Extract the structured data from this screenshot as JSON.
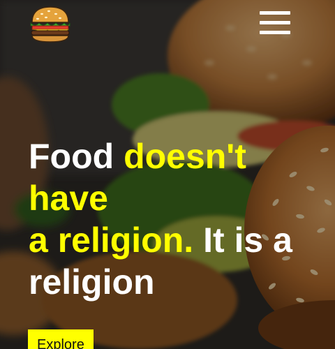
{
  "header": {
    "logo_icon": "burger-logo-icon",
    "menu_icon": "hamburger-menu-icon"
  },
  "hero": {
    "headline_1": "Food ",
    "headline_2": "doesn't have",
    "headline_3": "a religion.",
    "headline_4": " It is a religion",
    "explore_label": "Explore",
    "accent_color": "#ffff00",
    "text_color": "#ffffff"
  }
}
